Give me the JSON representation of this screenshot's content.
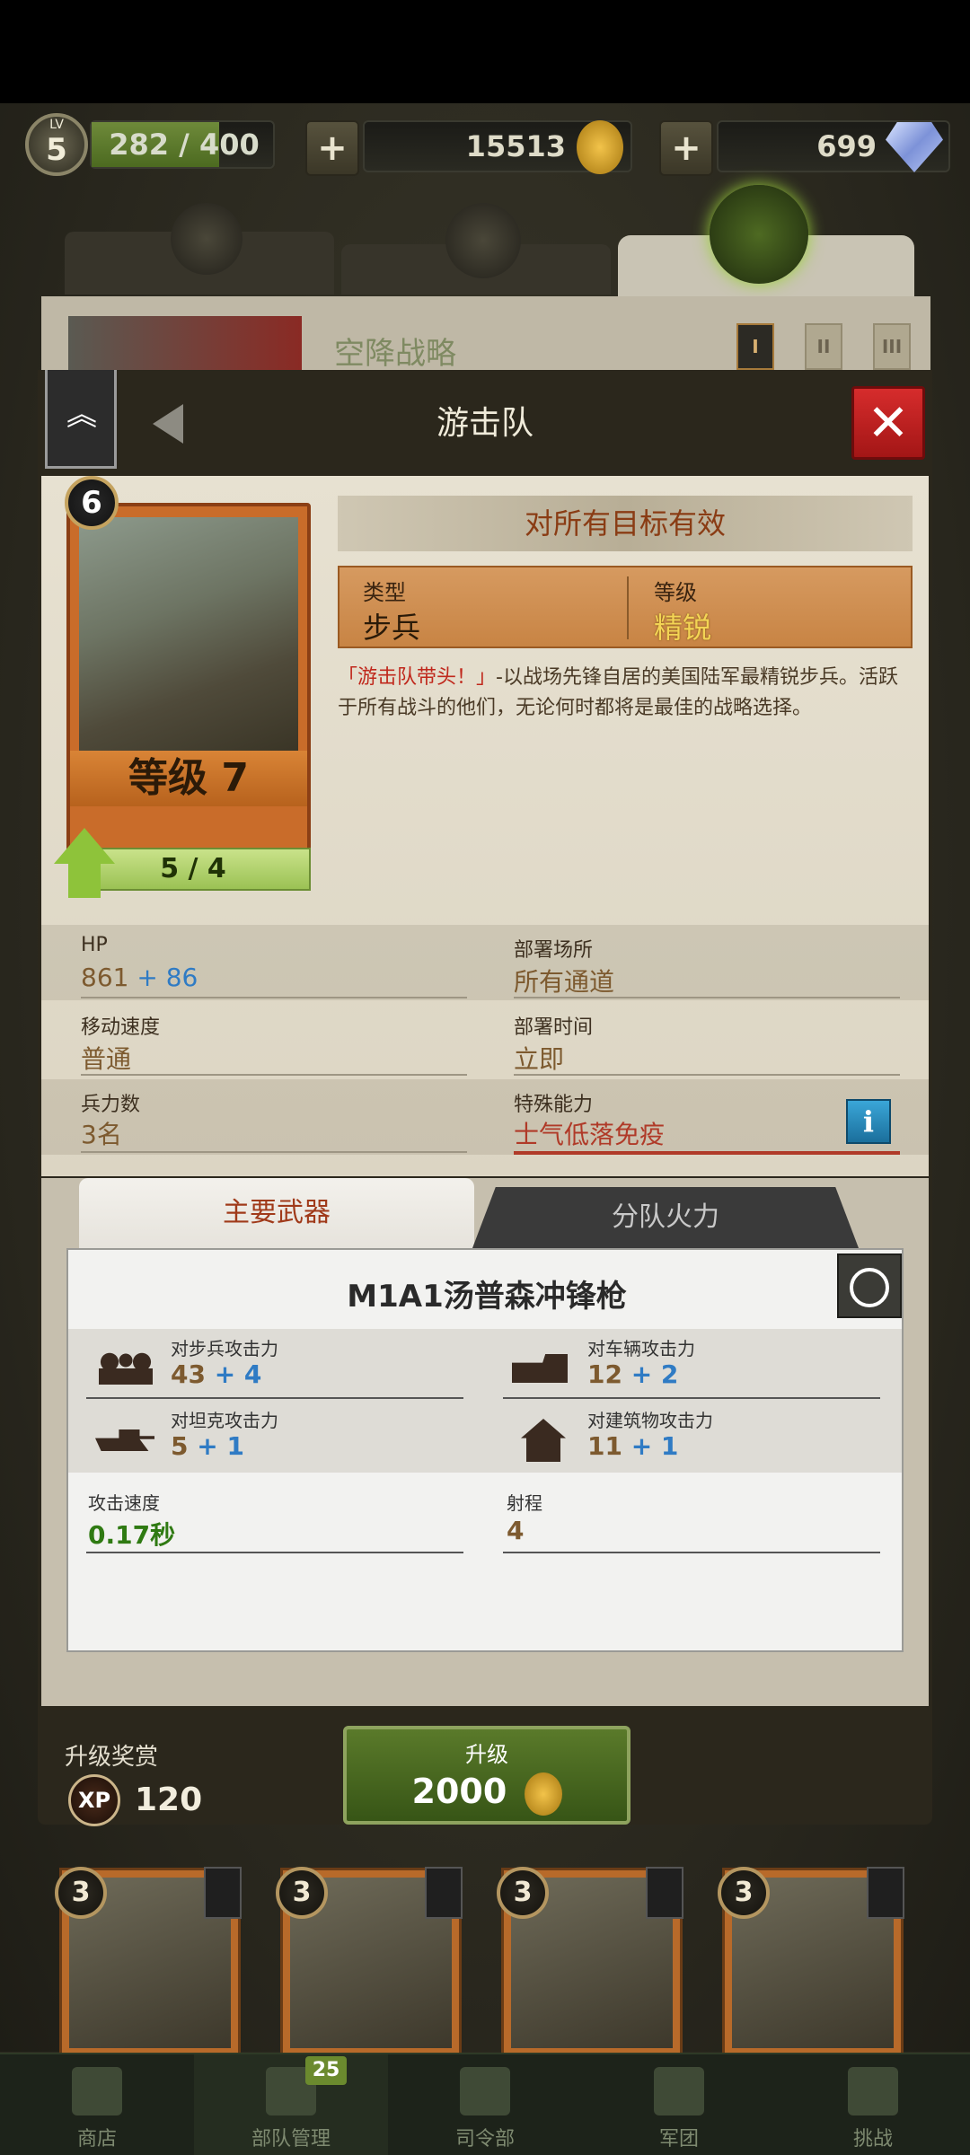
{
  "top_bar": {
    "level_prefix": "LV",
    "level": "5",
    "xp_progress": "282 / 400",
    "xp_fraction": 0.705,
    "gold": "15513",
    "gems": "699",
    "plus_label": "+"
  },
  "background_panel": {
    "title": "空降战略",
    "tiers": [
      "I",
      "II",
      "III"
    ]
  },
  "dialog": {
    "title": "游击队",
    "unit_card": {
      "rank": "6",
      "level_label": "等级 7",
      "progress": "5 / 4"
    },
    "effect_banner": "对所有目标有效",
    "type_label": "类型",
    "type_value": "步兵",
    "grade_label": "等级",
    "grade_value": "精锐",
    "description_highlight": "「游击队带头！」",
    "description": "-以战场先锋自居的美国陆军最精锐步兵。活跃于所有战斗的他们，无论何时都将是最佳的战略选择。",
    "stats": [
      {
        "label": "HP",
        "value": "861",
        "bonus": "+ 86"
      },
      {
        "label": "部署场所",
        "value": "所有通道",
        "bonus": ""
      },
      {
        "label": "移动速度",
        "value": "普通",
        "bonus": ""
      },
      {
        "label": "部署时间",
        "value": "立即",
        "bonus": ""
      },
      {
        "label": "兵力数",
        "value": "3名",
        "bonus": ""
      },
      {
        "label": "特殊能力",
        "value": "士气低落免疫",
        "bonus": ""
      }
    ],
    "weapon_tabs": [
      "主要武器",
      "分队火力"
    ],
    "weapon": {
      "name": "M1A1汤普森冲锋枪",
      "attack": [
        {
          "label": "对步兵攻击力",
          "value": "43",
          "bonus": "+ 4",
          "icon": "infantry-icon"
        },
        {
          "label": "对车辆攻击力",
          "value": "12",
          "bonus": "+ 2",
          "icon": "vehicle-icon"
        },
        {
          "label": "对坦克攻击力",
          "value": "5",
          "bonus": "+ 1",
          "icon": "tank-icon"
        },
        {
          "label": "对建筑物攻击力",
          "value": "11",
          "bonus": "+ 1",
          "icon": "building-icon"
        }
      ],
      "attack_speed_label": "攻击速度",
      "attack_speed_value": "0.17秒",
      "range_label": "射程",
      "range_value": "4"
    },
    "footer": {
      "reward_label": "升级奖赏",
      "xp_badge": "XP",
      "xp_amount": "120",
      "upgrade_label": "升级",
      "upgrade_cost": "2000"
    }
  },
  "bottom_cards": [
    "3",
    "3",
    "3",
    "3"
  ],
  "bottom_nav": {
    "items": [
      "商店",
      "部队管理",
      "司令部",
      "军团",
      "挑战"
    ],
    "badge": "25"
  },
  "colors": {
    "accent_gold": "#c8932a",
    "upgrade_green": "#375516",
    "close_red": "#c02020",
    "bonus_blue": "#2f7bc4",
    "speed_green": "#2f7a12"
  }
}
